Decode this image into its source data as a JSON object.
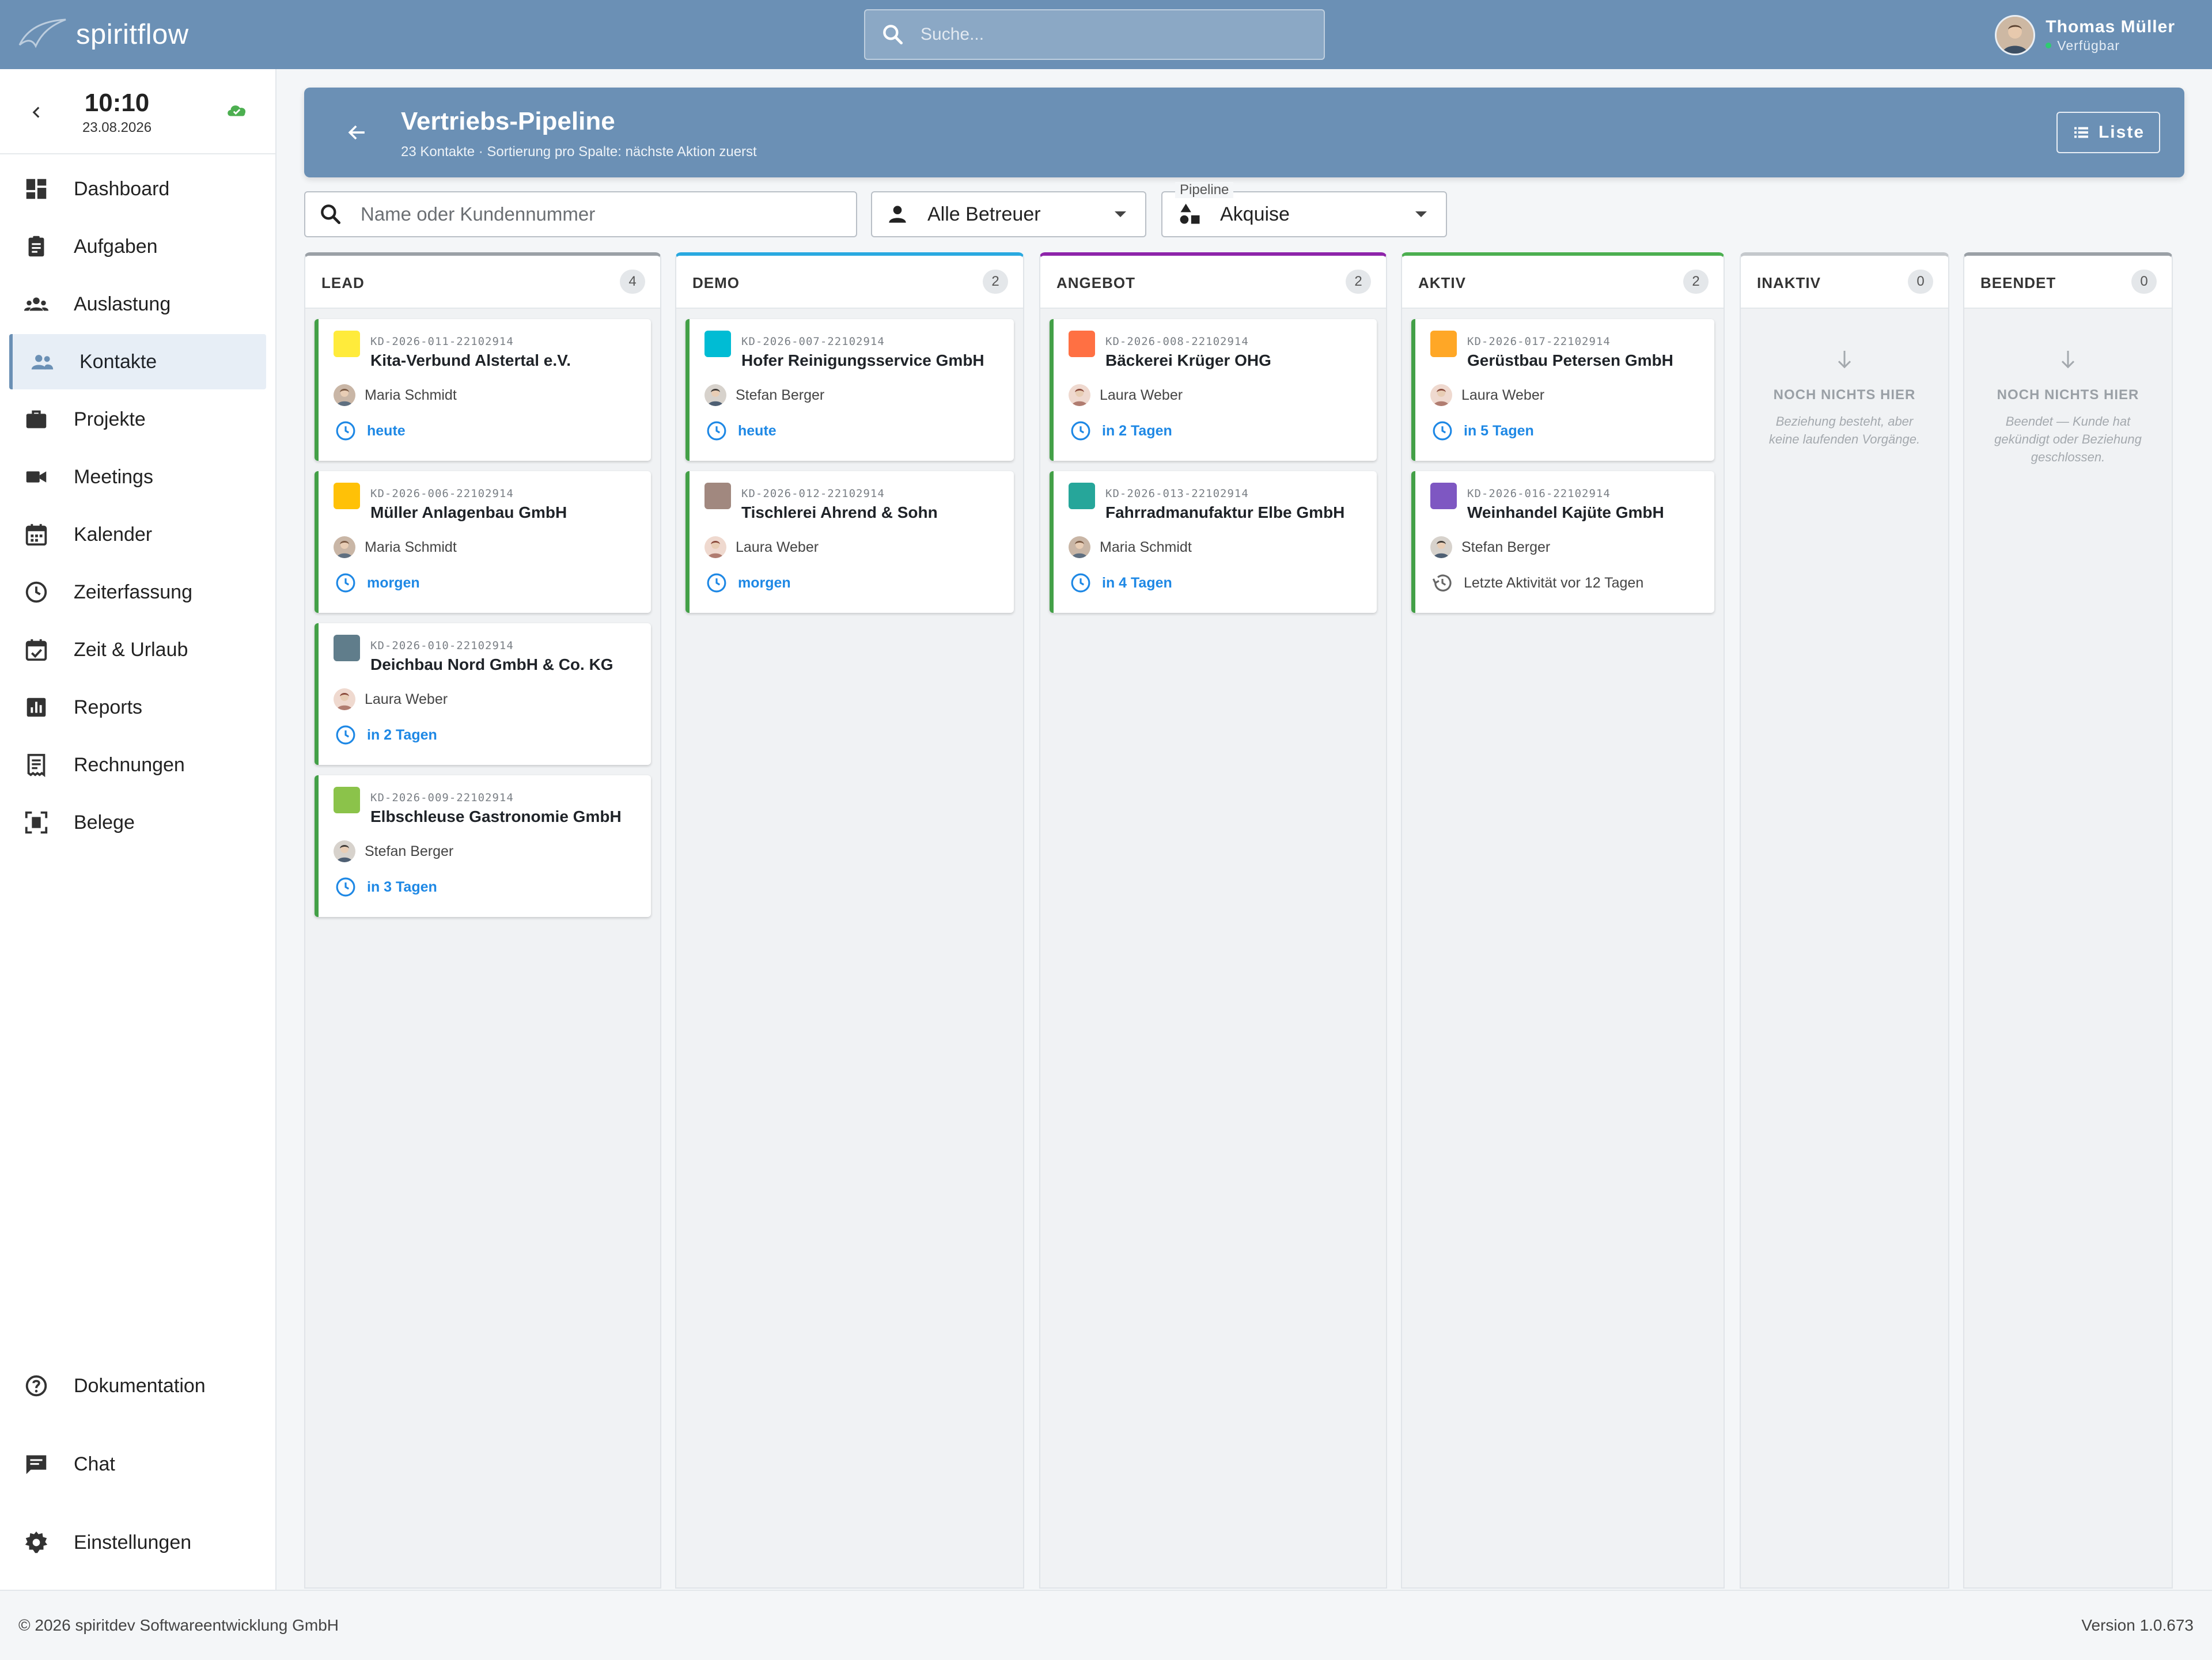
{
  "app": {
    "name": "spiritflow",
    "search_placeholder": "Suche...",
    "user_name": "Thomas Müller",
    "user_status": "Verfügbar"
  },
  "clock": {
    "time": "10:10",
    "date": "23.08.2026"
  },
  "nav": {
    "items": [
      {
        "label": "Dashboard",
        "icon": "dashboard-icon"
      },
      {
        "label": "Aufgaben",
        "icon": "clipboard-icon"
      },
      {
        "label": "Auslastung",
        "icon": "groups-icon"
      },
      {
        "label": "Kontakte",
        "icon": "people-icon",
        "active": true
      },
      {
        "label": "Projekte",
        "icon": "briefcase-icon"
      },
      {
        "label": "Meetings",
        "icon": "videocam-icon"
      },
      {
        "label": "Kalender",
        "icon": "calendar-icon"
      },
      {
        "label": "Zeiterfassung",
        "icon": "clock-icon"
      },
      {
        "label": "Zeit & Urlaub",
        "icon": "event-check-icon"
      },
      {
        "label": "Reports",
        "icon": "bar-chart-icon"
      },
      {
        "label": "Rechnungen",
        "icon": "receipt-icon"
      },
      {
        "label": "Belege",
        "icon": "document-scan-icon"
      }
    ],
    "bottom": [
      {
        "label": "Dokumentation",
        "icon": "help-icon"
      },
      {
        "label": "Chat",
        "icon": "chat-icon"
      },
      {
        "label": "Einstellungen",
        "icon": "gear-icon"
      }
    ]
  },
  "header": {
    "title": "Vertriebs-Pipeline",
    "subtitle": "23 Kontakte · Sortierung pro Spalte: nächste Aktion zuerst",
    "list_button": "Liste"
  },
  "filters": {
    "search_placeholder": "Name oder Kundennummer",
    "owner_value": "Alle Betreuer",
    "pipeline_label": "Pipeline",
    "pipeline_value": "Akquise"
  },
  "columns": [
    {
      "title": "LEAD",
      "count": "4",
      "color": "#9aa0a6",
      "cards": [
        {
          "id": "KD-2026-011-22102914",
          "name": "Kita-Verbund Alstertal e.V.",
          "color": "#ffeb3b",
          "owner": "Maria Schmidt",
          "due": "heute"
        },
        {
          "id": "KD-2026-006-22102914",
          "name": "Müller Anlagenbau GmbH",
          "color": "#ffc107",
          "owner": "Maria Schmidt",
          "due": "morgen"
        },
        {
          "id": "KD-2026-010-22102914",
          "name": "Deichbau Nord GmbH & Co. KG",
          "color": "#607d8b",
          "owner": "Laura Weber",
          "due": "in 2 Tagen"
        },
        {
          "id": "KD-2026-009-22102914",
          "name": "Elbschleuse Gastronomie GmbH",
          "color": "#8bc34a",
          "owner": "Stefan Berger",
          "due": "in 3 Tagen"
        }
      ]
    },
    {
      "title": "DEMO",
      "count": "2",
      "color": "#29a9e0",
      "cards": [
        {
          "id": "KD-2026-007-22102914",
          "name": "Hofer Reinigungsservice GmbH",
          "color": "#00bcd4",
          "owner": "Stefan Berger",
          "due": "heute"
        },
        {
          "id": "KD-2026-012-22102914",
          "name": "Tischlerei Ahrend & Sohn",
          "color": "#a1887f",
          "owner": "Laura Weber",
          "due": "morgen"
        }
      ]
    },
    {
      "title": "ANGEBOT",
      "count": "2",
      "color": "#8e24aa",
      "cards": [
        {
          "id": "KD-2026-008-22102914",
          "name": "Bäckerei Krüger OHG",
          "color": "#ff7043",
          "owner": "Laura Weber",
          "due": "in 2 Tagen"
        },
        {
          "id": "KD-2026-013-22102914",
          "name": "Fahrradmanufaktur Elbe GmbH",
          "color": "#26a69a",
          "owner": "Maria Schmidt",
          "due": "in 4 Tagen"
        }
      ]
    },
    {
      "title": "AKTIV",
      "count": "2",
      "color": "#4caf50",
      "cards": [
        {
          "id": "KD-2026-017-22102914",
          "name": "Gerüstbau Petersen GmbH",
          "color": "#ffa726",
          "owner": "Laura Weber",
          "due": "in 5 Tagen"
        },
        {
          "id": "KD-2026-016-22102914",
          "name": "Weinhandel Kajüte GmbH",
          "color": "#7e57c2",
          "owner": "Stefan Berger",
          "activity": "Letzte Aktivität vor 12 Tagen"
        }
      ]
    },
    {
      "title": "INAKTIV",
      "count": "0",
      "color": "#c4c8cc",
      "empty_title": "NOCH NICHTS HIER",
      "empty_sub": "Beziehung besteht, aber keine laufenden Vorgänge."
    },
    {
      "title": "BEENDET",
      "count": "0",
      "color": "#9aa0a6",
      "empty_title": "NOCH NICHTS HIER",
      "empty_sub": "Beendet — Kunde hat gekündigt oder Beziehung geschlossen."
    }
  ],
  "footer": {
    "copyright": "© 2026 spiritdev Softwareentwicklung GmbH",
    "version": "Version 1.0.673"
  }
}
